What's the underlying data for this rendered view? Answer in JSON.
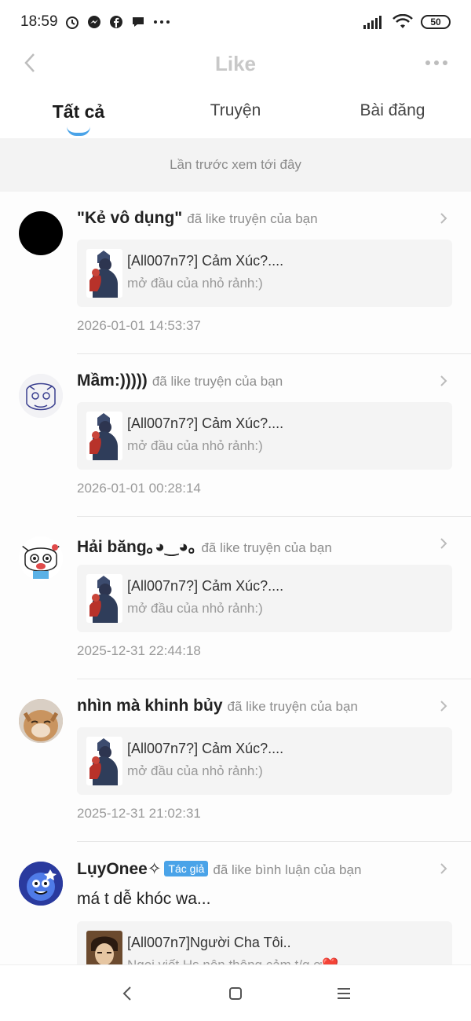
{
  "status_bar": {
    "time": "18:59",
    "battery": "50",
    "left_icons": [
      "alarm-icon",
      "messenger-icon",
      "facebook-icon",
      "chat-bubble-icon",
      "more-icon"
    ],
    "right_icons": [
      "signal-icon",
      "wifi-icon",
      "battery-icon"
    ]
  },
  "header": {
    "title": "Like"
  },
  "tabs": [
    {
      "label": "Tất cả",
      "active": true
    },
    {
      "label": "Truyện",
      "active": false
    },
    {
      "label": "Bài đăng",
      "active": false
    }
  ],
  "last_seen": "Lần trước xem tới đây",
  "items": [
    {
      "username": "\"Kẻ vô dụng\"",
      "action": "đã like truyện của bạn",
      "card_title": "[All007n7?] Cảm Xúc?....",
      "card_sub": "mở đầu của nhỏ rảnh:)",
      "timestamp": "2026-01-01 14:53:37"
    },
    {
      "username": "Mầm:)))))",
      "action": "đã like truyện của bạn",
      "card_title": "[All007n7?] Cảm Xúc?....",
      "card_sub": "mở đầu của nhỏ rảnh:)",
      "timestamp": "2026-01-01 00:28:14"
    },
    {
      "username": "Hải băng｡◕‿◕｡",
      "action": "đã like truyện của bạn",
      "card_title": "[All007n7?] Cảm Xúc?....",
      "card_sub": "mở đầu của nhỏ rảnh:)",
      "timestamp": "2025-12-31 22:44:18"
    },
    {
      "username": "nhìn mà khinh bủy",
      "action": "đã like truyện của bạn",
      "card_title": "[All007n7?] Cảm Xúc?....",
      "card_sub": "mở đầu của nhỏ rảnh:)",
      "timestamp": "2025-12-31 21:02:31"
    },
    {
      "username": "LụyOnee✧",
      "badge": "Tác giả",
      "action": "đã like bình luận của bạn",
      "comment": "má t dễ khóc wa...",
      "card_title": "[All007n7]Người Cha Tôi..",
      "card_sub": "Ngọi viết Hs nên thông cảm t/g ơ❤️"
    }
  ],
  "colors": {
    "accent": "#4aa3e8",
    "title_gray": "#c8c8c8"
  },
  "bottom_nav": [
    "back-nav-icon",
    "home-nav-icon",
    "menu-nav-icon"
  ]
}
